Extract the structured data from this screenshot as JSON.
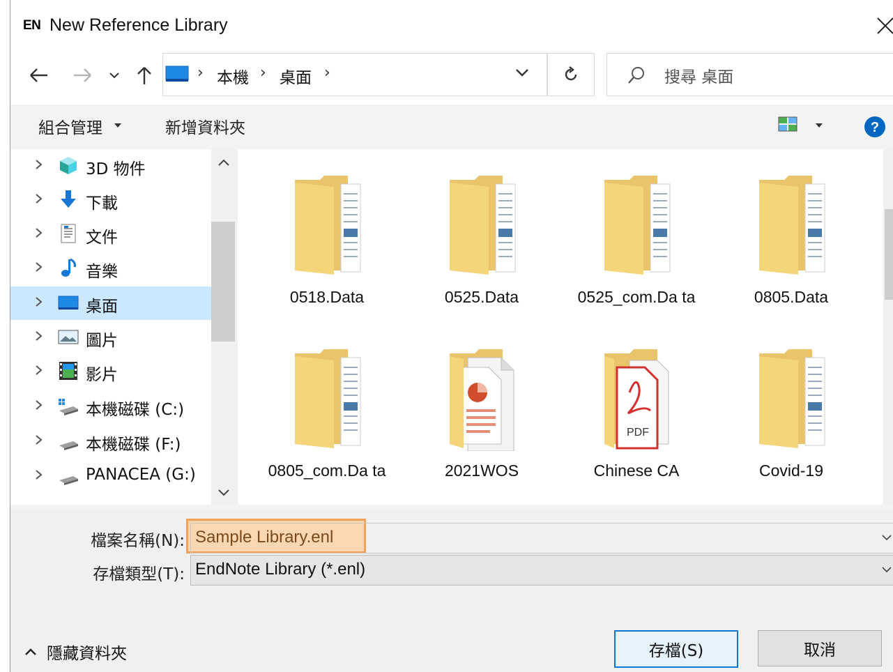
{
  "window": {
    "app_badge": "EN",
    "title": "New Reference Library"
  },
  "nav": {
    "breadcrumb": [
      "本機",
      "桌面"
    ],
    "search_placeholder": "搜尋 桌面"
  },
  "toolbar": {
    "organize_label": "組合管理",
    "new_folder_label": "新增資料夾"
  },
  "tree": {
    "items": [
      {
        "label": "3D 物件",
        "icon": "3d-objects-icon"
      },
      {
        "label": "下載",
        "icon": "download-icon"
      },
      {
        "label": "文件",
        "icon": "documents-icon"
      },
      {
        "label": "音樂",
        "icon": "music-icon"
      },
      {
        "label": "桌面",
        "icon": "desktop-icon",
        "selected": true
      },
      {
        "label": "圖片",
        "icon": "pictures-icon"
      },
      {
        "label": "影片",
        "icon": "videos-icon"
      },
      {
        "label": "本機磁碟 (C:)",
        "icon": "drive-c-icon"
      },
      {
        "label": "本機磁碟 (F:)",
        "icon": "drive-icon"
      },
      {
        "label": "PANACEA (G:)",
        "icon": "drive-icon"
      }
    ]
  },
  "files": [
    {
      "name": "0518.Data",
      "type": "folder"
    },
    {
      "name": "0525.Data",
      "type": "folder"
    },
    {
      "name": "0525_com.Da ta",
      "type": "folder"
    },
    {
      "name": "0805.Data",
      "type": "folder"
    },
    {
      "name": "0805_com.Da ta",
      "type": "folder"
    },
    {
      "name": "2021WOS",
      "type": "folder-office"
    },
    {
      "name": "Chinese CA",
      "type": "folder-pdf"
    },
    {
      "name": "Covid-19",
      "type": "folder"
    }
  ],
  "form": {
    "filename_label": "檔案名稱(N):",
    "filename_value": "Sample Library.enl",
    "filetype_label": "存檔類型(T):",
    "filetype_value": "EndNote Library (*.enl)"
  },
  "footer": {
    "hide_folders_label": "隱藏資料夾",
    "save_label": "存檔(S)",
    "cancel_label": "取消"
  },
  "colors": {
    "selection": "#cce8ff",
    "highlight": "#fbd7b1",
    "help": "#0067c0",
    "folder": "#f5d57a"
  }
}
